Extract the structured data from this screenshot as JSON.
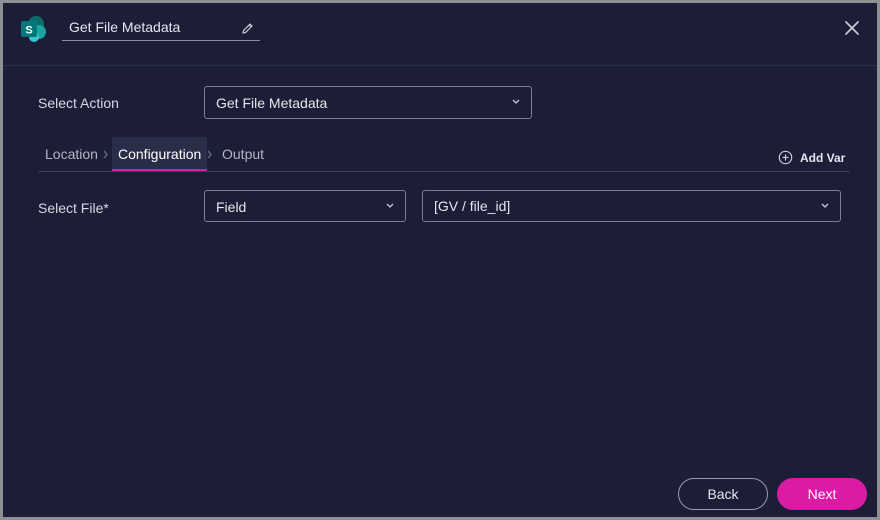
{
  "header": {
    "title": "Get File Metadata",
    "logo_icon": "sharepoint-logo-icon",
    "edit_icon": "pencil-icon",
    "close_icon": "close-icon"
  },
  "form": {
    "select_action_label": "Select Action",
    "select_action_value": "Get File Metadata",
    "select_file_label": "Select File*",
    "file_source_value": "Field",
    "file_value": "[GV / file_id]"
  },
  "tabs": [
    {
      "label": "Location",
      "active": false
    },
    {
      "label": "Configuration",
      "active": true
    },
    {
      "label": "Output",
      "active": false
    }
  ],
  "add_var_label": "Add Var",
  "footer": {
    "back_label": "Back",
    "next_label": "Next"
  },
  "colors": {
    "background": "#1b1e36",
    "accent": "#d91ba5",
    "brand": "#0c8f8a"
  }
}
